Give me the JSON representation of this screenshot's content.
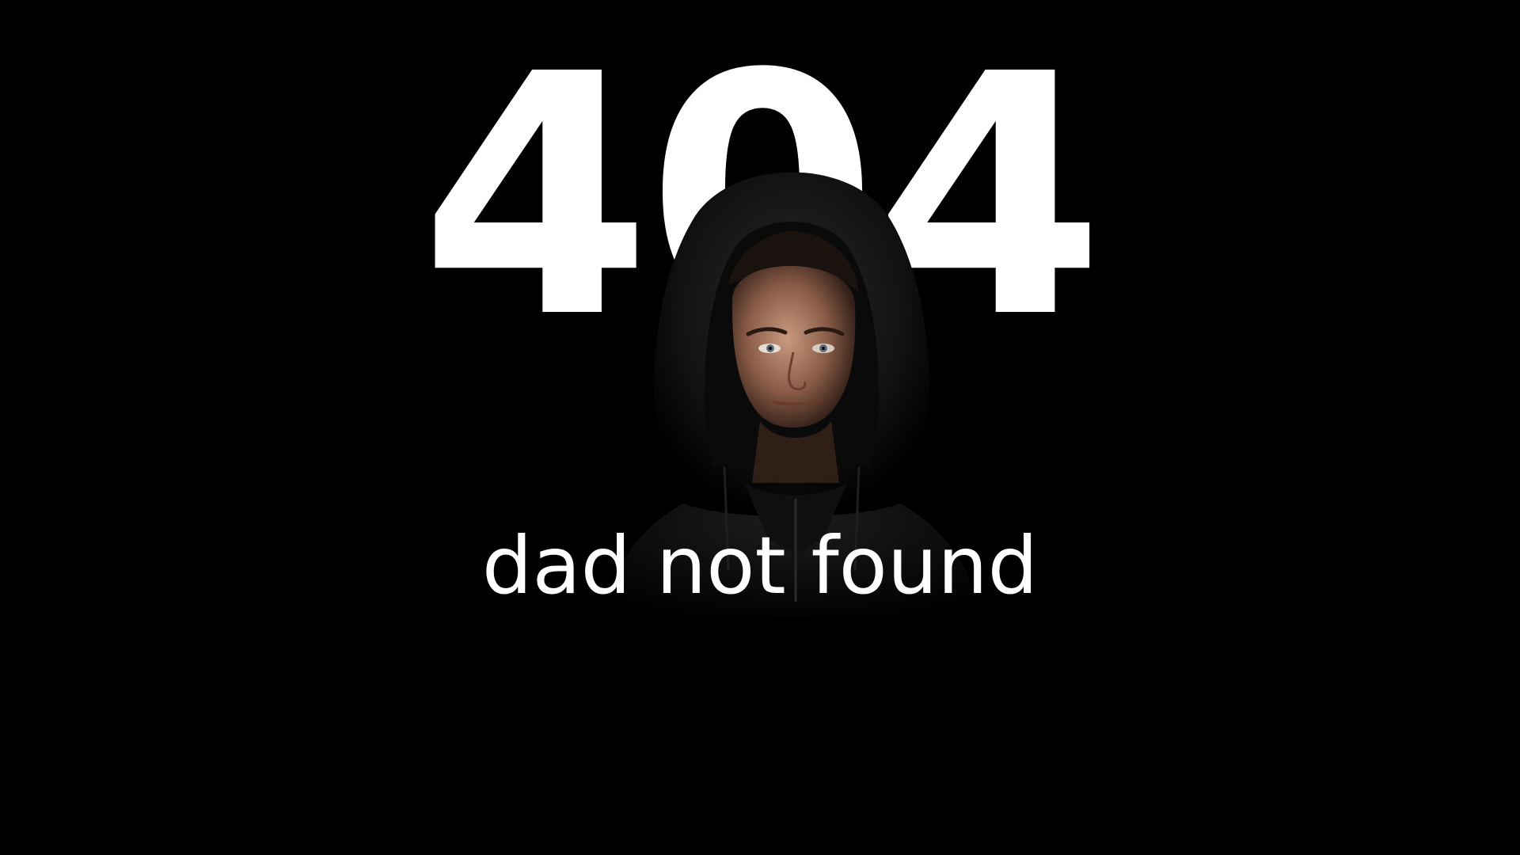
{
  "page": {
    "error_code": "404",
    "message": "dad not found",
    "background_color": "#000000",
    "text_color": "#ffffff"
  },
  "hero_image": {
    "subject": "person-in-black-hoodie"
  }
}
